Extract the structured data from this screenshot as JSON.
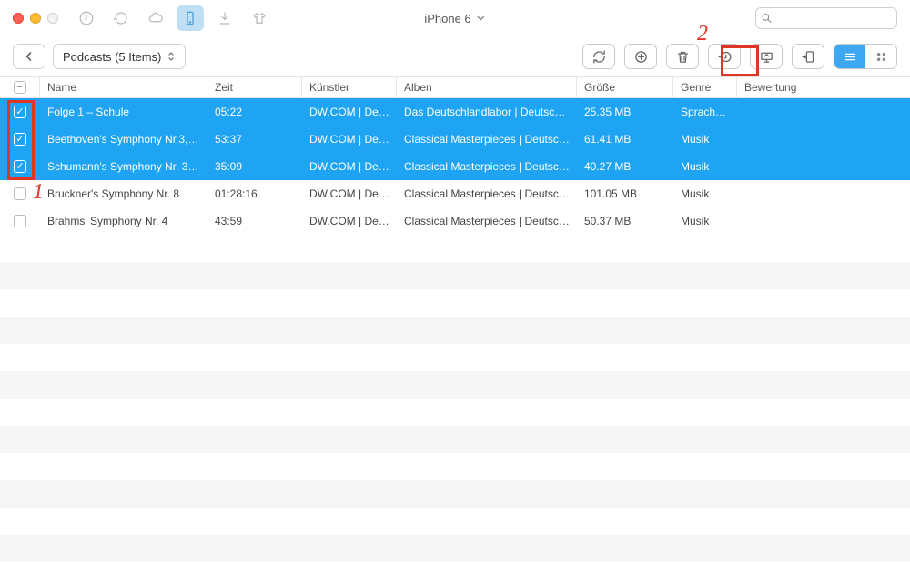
{
  "device": {
    "name": "iPhone 6"
  },
  "breadcrumb": {
    "label": "Podcasts (5 Items)"
  },
  "search": {
    "placeholder": ""
  },
  "columns": {
    "name": "Name",
    "zeit": "Zeit",
    "kuenstler": "Künstler",
    "alben": "Alben",
    "groesse": "Größe",
    "genre": "Genre",
    "bewertung": "Bewertung"
  },
  "rows": [
    {
      "selected": true,
      "name": "Folge 1 – Schule",
      "zeit": "05:22",
      "kuenstler": "DW.COM | Deut…",
      "alben": "Das Deutschlandlabor | Deutsch l…",
      "groesse": "25.35 MB",
      "genre": "Sprachk…"
    },
    {
      "selected": true,
      "name": "Beethoven's Symphony Nr.3, t…",
      "zeit": "53:37",
      "kuenstler": "DW.COM | Deut…",
      "alben": "Classical Masterpieces | Deutsch…",
      "groesse": "61.41 MB",
      "genre": "Musik"
    },
    {
      "selected": true,
      "name": "Schumann's Symphony Nr. 3,…",
      "zeit": "35:09",
      "kuenstler": "DW.COM | Deut…",
      "alben": "Classical Masterpieces | Deutsch…",
      "groesse": "40.27 MB",
      "genre": "Musik"
    },
    {
      "selected": false,
      "name": "Bruckner's Symphony Nr. 8",
      "zeit": "01:28:16",
      "kuenstler": "DW.COM | Deut…",
      "alben": "Classical Masterpieces | Deutsch…",
      "groesse": "101.05 MB",
      "genre": "Musik"
    },
    {
      "selected": false,
      "name": "Brahms' Symphony Nr. 4",
      "zeit": "43:59",
      "kuenstler": "DW.COM | Deut…",
      "alben": "Classical Masterpieces | Deutsch…",
      "groesse": "50.37 MB",
      "genre": "Musik"
    }
  ],
  "annotations": {
    "label1": "1",
    "label2": "2"
  }
}
